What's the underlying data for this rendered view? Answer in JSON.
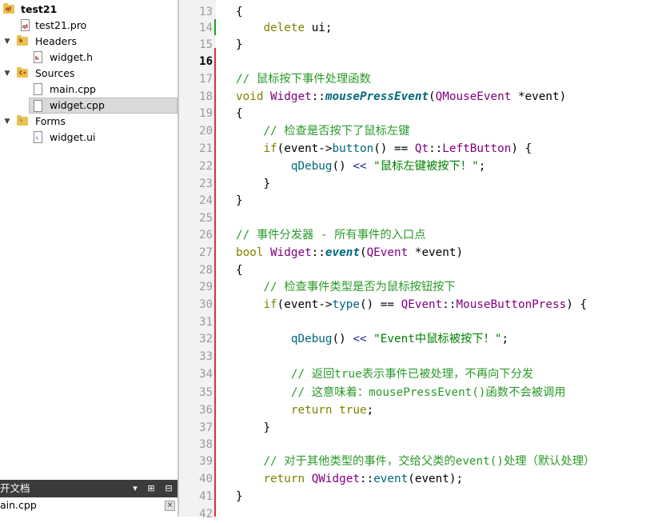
{
  "project_tree": {
    "project": "test21",
    "items": [
      {
        "label": "test21",
        "kind": "project",
        "icon": "qt-project-icon",
        "expanded": true
      },
      {
        "label": "test21.pro",
        "kind": "file",
        "icon": "pro-file-icon"
      },
      {
        "label": "Headers",
        "kind": "folder",
        "icon": "headers-folder-icon",
        "expanded": true
      },
      {
        "label": "widget.h",
        "kind": "file",
        "icon": "header-file-icon"
      },
      {
        "label": "Sources",
        "kind": "folder",
        "icon": "sources-folder-icon",
        "expanded": true
      },
      {
        "label": "main.cpp",
        "kind": "file",
        "icon": "cpp-file-icon"
      },
      {
        "label": "widget.cpp",
        "kind": "file",
        "icon": "cpp-file-icon",
        "selected": true
      },
      {
        "label": "Forms",
        "kind": "folder",
        "icon": "forms-folder-icon",
        "expanded": true
      },
      {
        "label": "widget.ui",
        "kind": "file",
        "icon": "ui-file-icon"
      }
    ]
  },
  "open_documents": {
    "title": "开文档",
    "files": [
      "ain.cpp"
    ],
    "buttons": {
      "dropdown": "▾",
      "split": "⊞",
      "close": "⊟"
    },
    "close_glyph": "×"
  },
  "editor": {
    "current_line": 16,
    "lines": [
      {
        "n": "13",
        "fold": ""
      },
      {
        "n": "14",
        "fold": ""
      },
      {
        "n": "15",
        "fold": ""
      },
      {
        "n": "16",
        "fold": ""
      },
      {
        "n": "17",
        "fold": ""
      },
      {
        "n": "18",
        "fold": "▾"
      },
      {
        "n": "19",
        "fold": ""
      },
      {
        "n": "20",
        "fold": ""
      },
      {
        "n": "21",
        "fold": "▾"
      },
      {
        "n": "22",
        "fold": ""
      },
      {
        "n": "23",
        "fold": ""
      },
      {
        "n": "24",
        "fold": ""
      },
      {
        "n": "25",
        "fold": ""
      },
      {
        "n": "26",
        "fold": ""
      },
      {
        "n": "27",
        "fold": "▾"
      },
      {
        "n": "28",
        "fold": ""
      },
      {
        "n": "29",
        "fold": ""
      },
      {
        "n": "30",
        "fold": "▾"
      },
      {
        "n": "31",
        "fold": ""
      },
      {
        "n": "32",
        "fold": ""
      },
      {
        "n": "33",
        "fold": ""
      },
      {
        "n": "34",
        "fold": ""
      },
      {
        "n": "35",
        "fold": ""
      },
      {
        "n": "36",
        "fold": ""
      },
      {
        "n": "37",
        "fold": ""
      },
      {
        "n": "38",
        "fold": ""
      },
      {
        "n": "39",
        "fold": ""
      },
      {
        "n": "40",
        "fold": ""
      },
      {
        "n": "41",
        "fold": ""
      },
      {
        "n": "42",
        "fold": ""
      }
    ],
    "code": {
      "l13_brace": "{",
      "l14_kw": "delete",
      "l14_rest": " ui;",
      "l15_brace": "}",
      "l17_comment": "// 鼠标按下事件处理函数",
      "l18_kw": "void",
      "l18_class": "Widget",
      "l18_sep": "::",
      "l18_fn": "mousePressEvent",
      "l18_open": "(",
      "l18_ptype": "QMouseEvent",
      "l18_param": " *event)",
      "l19_brace": "{",
      "l20_comment": "// 检查是否按下了鼠标左键",
      "l21_kw": "if",
      "l21_a": "(event->",
      "l21_call": "button",
      "l21_b": "() == ",
      "l21_ns": "Qt",
      "l21_sep": "::",
      "l21_enum": "LeftButton",
      "l21_c": ") {",
      "l22_call": "qDebug",
      "l22_a": "() ",
      "l22_op": "<<",
      "l22_str": " \"鼠标左键被按下！\"",
      "l22_end": ";",
      "l23_brace": "}",
      "l24_brace": "}",
      "l26_comment": "// 事件分发器 - 所有事件的入口点",
      "l27_kw": "bool",
      "l27_class": "Widget",
      "l27_sep": "::",
      "l27_fn": "event",
      "l27_open": "(",
      "l27_ptype": "QEvent",
      "l27_param": " *event)",
      "l28_brace": "{",
      "l29_comment": "// 检查事件类型是否为鼠标按钮按下",
      "l30_kw": "if",
      "l30_a": "(event->",
      "l30_call": "type",
      "l30_b": "() == ",
      "l30_ns": "QEvent",
      "l30_sep": "::",
      "l30_enum": "MouseButtonPress",
      "l30_c": ") {",
      "l32_call": "qDebug",
      "l32_a": "() ",
      "l32_op": "<<",
      "l32_str": " \"Event中鼠标被按下！\"",
      "l32_end": ";",
      "l34_comment": "// 返回true表示事件已被处理，不再向下分发",
      "l35_comment": "// 这意味着：mousePressEvent()函数不会被调用",
      "l36_kw": "return",
      "l36_val": " true",
      "l36_end": ";",
      "l37_brace": "}",
      "l39_comment": "// 对于其他类型的事件，交给父类的event()处理（默认处理）",
      "l40_kw": "return",
      "l40_cls": " QWidget",
      "l40_sep": "::",
      "l40_call": "event",
      "l40_rest": "(event);",
      "l41_brace": "}"
    }
  },
  "colors": {
    "comment": "#2a9a2a",
    "keyword": "#808000",
    "type": "#800080",
    "function": "#00677c",
    "modified_marker": "#e23030",
    "saved_marker": "#1fa01f"
  }
}
